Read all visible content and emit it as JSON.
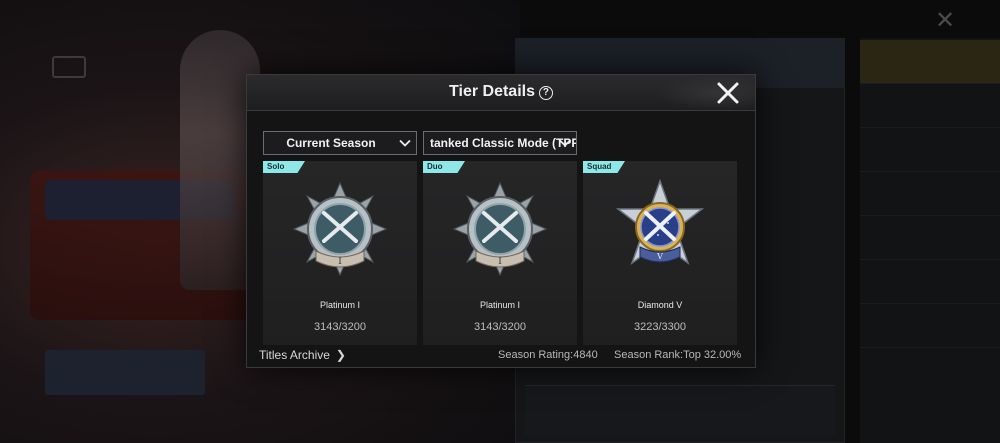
{
  "modal": {
    "title": "Tier Details",
    "help_glyph": "?",
    "season_dropdown": "Current Season",
    "mode_dropdown": "tanked Classic Mode (TPP"
  },
  "cards": [
    {
      "tag": "Solo",
      "tier": "Platinum I",
      "score": "3143/3200",
      "badge": "platinum-badge-icon"
    },
    {
      "tag": "Duo",
      "tier": "Platinum I",
      "score": "3143/3200",
      "badge": "platinum-badge-icon"
    },
    {
      "tag": "Squad",
      "tier": "Diamond V",
      "score": "3223/3300",
      "badge": "diamond-badge-icon"
    }
  ],
  "footer": {
    "titles_archive": "Titles Archive",
    "season_rating": "Season Rating:4840",
    "season_rank": "Season Rank:Top 32.00%"
  },
  "colors": {
    "tag_bg": "#8fe8e8",
    "modal_bg": "#141415",
    "card_bg": "#262627"
  }
}
